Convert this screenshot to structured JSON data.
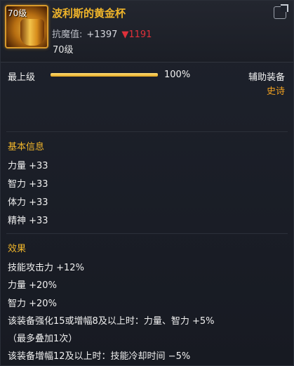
{
  "item": {
    "icon_level": "70级",
    "name": "波利斯的黄金杯",
    "stat_label": "抗魔值:",
    "stat_value": "+1397",
    "stat_change": "▼1191",
    "level": "70级"
  },
  "colors": {
    "name_gold": "#f0b52a",
    "section_gold": "#f0b52a",
    "rarity_orange": "#f0a020",
    "decrease_red": "#e0303a"
  },
  "upgrade": {
    "label": "最上级",
    "progress_percent": 100,
    "percent_text": "100%"
  },
  "equip_type": "辅助装备",
  "rarity": "史诗",
  "basic_info": {
    "title": "基本信息",
    "lines": [
      "力量 +33",
      "智力 +33",
      "体力 +33",
      "精神 +33"
    ]
  },
  "effects": {
    "title": "效果",
    "lines": [
      "技能攻击力 +12%",
      "力量 +20%",
      "智力 +20%",
      "该装备强化15或增幅8及以上时：力量、智力 +5%",
      "（最多叠加1次）",
      "该装备增幅12及以上时：技能冷却时间 −5%"
    ]
  },
  "icons": [
    "equipment-cup-icon",
    "share-icon"
  ]
}
